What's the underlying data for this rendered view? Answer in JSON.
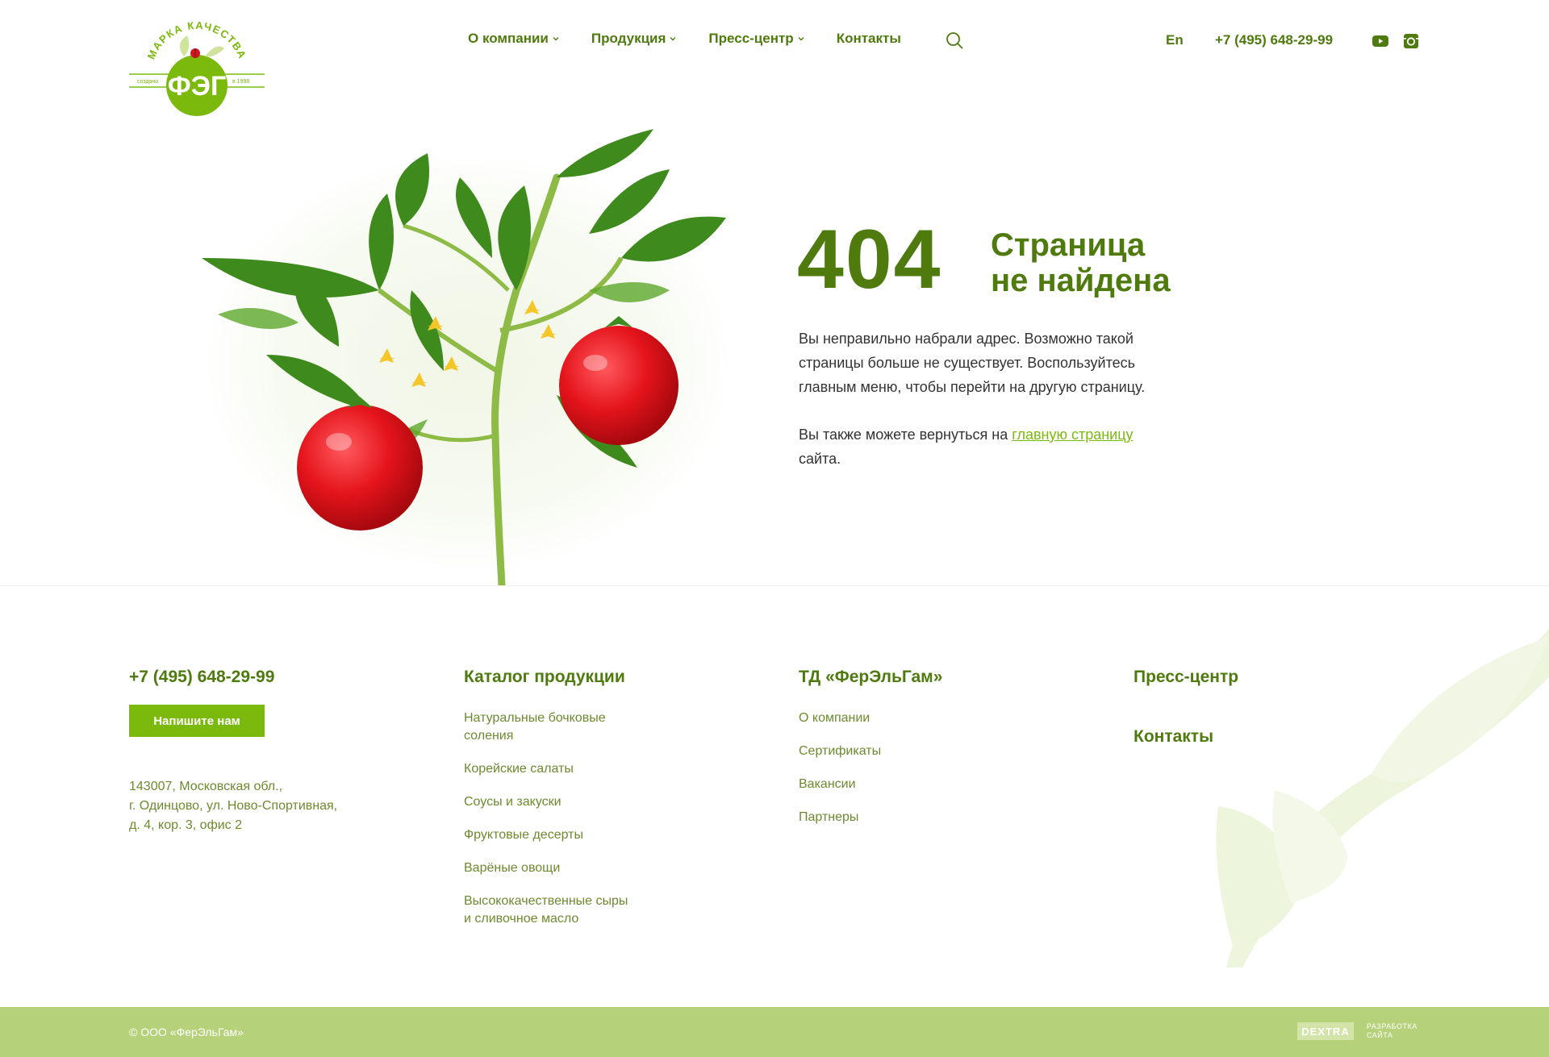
{
  "header": {
    "logo": {
      "arc_text": "МАРКА КАЧЕСТВА",
      "brand": "ФЭГ",
      "left_note": "создано",
      "right_note": "в 1998"
    },
    "nav": [
      {
        "label": "О компании",
        "has_dropdown": true
      },
      {
        "label": "Продукция",
        "has_dropdown": true
      },
      {
        "label": "Пресс-центр",
        "has_dropdown": true
      },
      {
        "label": "Контакты",
        "has_dropdown": false
      }
    ],
    "search_icon": "search-icon",
    "lang": "En",
    "phone": "+7 (495) 648-29-99",
    "social": [
      "youtube-icon",
      "instagram-icon"
    ]
  },
  "error": {
    "code": "404",
    "title_line1": "Страница",
    "title_line2": "не найдена",
    "text_line1": "Вы неправильно набрали адрес. Возможно такой",
    "text_line2": "страницы больше не существует. Воспользуйтесь",
    "text_line3": "главным меню, чтобы перейти на другую страницу.",
    "back_prefix": "Вы также можете вернуться на",
    "back_link": "главную страницу",
    "back_suffix": "сайта."
  },
  "footer": {
    "phone": "+7 (495) 648-29-99",
    "write_button": "Напишите нам",
    "address": [
      "143007, Московская обл.,",
      "г. Одинцово, ул. Ново-Спортивная,",
      "д. 4, кор. 3, офис 2"
    ],
    "catalog": {
      "title": "Каталог продукции",
      "items": [
        [
          "Натуральные бочковые",
          "соления"
        ],
        [
          "Корейские салаты"
        ],
        [
          "Соусы и закуски"
        ],
        [
          "Фруктовые десерты"
        ],
        [
          "Варёные овощи"
        ],
        [
          "Высококачественные сыры",
          "и сливочное масло"
        ]
      ]
    },
    "company": {
      "title": "ТД «ФерЭльГам»",
      "items": [
        "О компании",
        "Сертификаты",
        "Вакансии",
        "Партнеры"
      ]
    },
    "press": "Пресс-центр",
    "contacts": "Контакты",
    "copyright": "© ООО «ФерЭльГам»",
    "dev_logo": "DEXTRA",
    "dev_line1": "РАЗРАБОТКА",
    "dev_line2": "САЙТА"
  },
  "colors": {
    "brand_dark": "#4e7a0e",
    "brand_light": "#7bb90d",
    "footer_bar": "#b5d27a",
    "tomato": "#e5141b"
  }
}
